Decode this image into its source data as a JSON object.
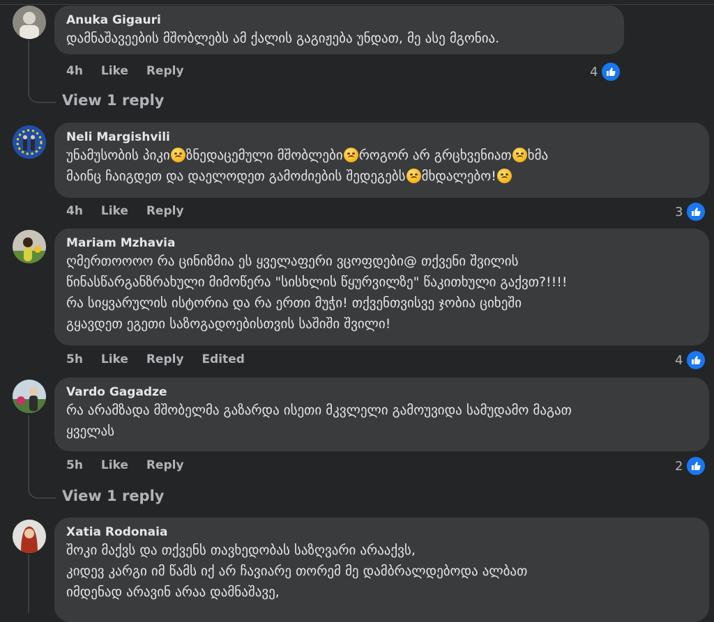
{
  "comments": [
    {
      "name": "Anuka Gigauri",
      "lines": [
        "დამნაშავეების მშობლებს ამ ქალის გაგიჟება უნდათ, მე ასე მგონია."
      ],
      "time": "4h",
      "like": "Like",
      "reply": "Reply",
      "count": "4"
    },
    {
      "name": "Neli Margishvili",
      "line1a": "უნამუსობის პიკი",
      "line1b": "ზნედაცემული მშობლები",
      "line1c": "როგორ არ გრცხვენიათ",
      "line1d": "ხმა",
      "line2a": "მაინც ჩაიგდეთ და დაელოდეთ გამოძიების შედეგებს",
      "line2b": "მხდალებო!",
      "time": "4h",
      "like": "Like",
      "reply": "Reply",
      "count": "3"
    },
    {
      "name": "Mariam Mzhavia",
      "lines": [
        "ღმერთოოოო რა ცინიზმია ეს ყველაფერი ვცოფდები@ თქვენი შვილის",
        "წინასწარგანზრახული მიმოწერა \"სისხლის წყურვილზე\" წაკითხული გაქვთ?!!!!",
        "რა სიყვარულის ისტორია და რა ერთი მუჭი! თქვენთვისვე ჯობია ციხეში",
        "გყავდეთ ეგეთი საზოგადოებისთვის საშიში შვილი!"
      ],
      "time": "5h",
      "like": "Like",
      "reply": "Reply",
      "edited": "Edited",
      "count": "4"
    },
    {
      "name": "Vardo Gagadze",
      "lines": [
        "რა არამზადა მშობელმა გაზარდა ისეთი მკვლელი გამოუვიდა სამუდამო მაგათ",
        "ყველას"
      ],
      "time": "5h",
      "like": "Like",
      "reply": "Reply",
      "count": "2"
    },
    {
      "name": "Xatia Rodonaia",
      "lines": [
        "შოკი მაქვს და თქვენს თავხედობას საზღვარი არააქვს,",
        "კიდევ კარგი იმ წამს იქ არ ჩავიარე თორემ მე დამბრალდებოდა ალბათ",
        "იმდენად არავინ არაა დამნაშავე,"
      ]
    }
  ],
  "view_replies": [
    "View 1 reply",
    "View 1 reply"
  ],
  "colors": {
    "bg": "#242526",
    "bubble": "#3a3b3c",
    "like_blue": "#1877f2",
    "meta": "#b0b3b8"
  }
}
